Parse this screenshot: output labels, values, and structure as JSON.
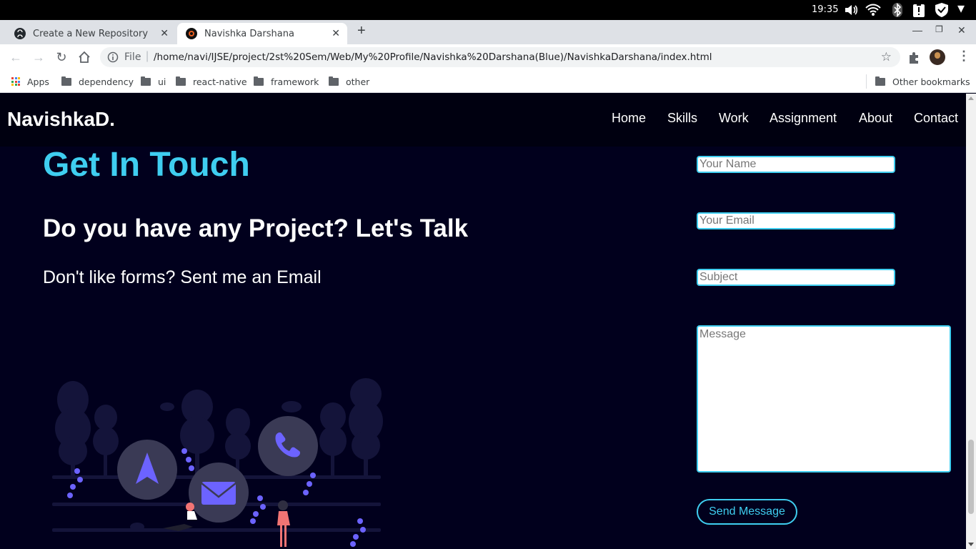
{
  "os": {
    "clock": "19:35"
  },
  "browser": {
    "tabs": [
      {
        "title": "Create a New Repository",
        "active": false
      },
      {
        "title": "Navishka Darshana",
        "active": true
      }
    ],
    "omnibox": {
      "scheme_label": "File",
      "url": "/home/navi/IJSE/project/2st%20Sem/Web/My%20Profile/Navishka%20Darshana(Blue)/NavishkaDarshana/index.html"
    },
    "bookmarks": [
      "Apps",
      "dependency",
      "ui",
      "react-native",
      "framework",
      "other"
    ],
    "other_bookmarks": "Other bookmarks"
  },
  "site": {
    "brand": "NavishkaD.",
    "nav": [
      "Home",
      "Skills",
      "Work",
      "Assignment",
      "About",
      "Contact"
    ],
    "contact": {
      "heading": "Get In Touch",
      "subheading": "Do you have any Project? Let's Talk",
      "tagline": "Don't like forms? Sent me an Email",
      "form": {
        "name_placeholder": "Your Name",
        "email_placeholder": "Your Email",
        "subject_placeholder": "Subject",
        "message_placeholder": "Message",
        "submit_label": "Send Message"
      }
    }
  },
  "colors": {
    "accent": "#3fcef0",
    "background": "#01001d",
    "nav_background": "#000010",
    "illustration": "#6c63ff"
  },
  "icons": [
    "github-icon",
    "site-favicon",
    "navigation-arrow-icon",
    "mail-icon",
    "phone-icon"
  ]
}
